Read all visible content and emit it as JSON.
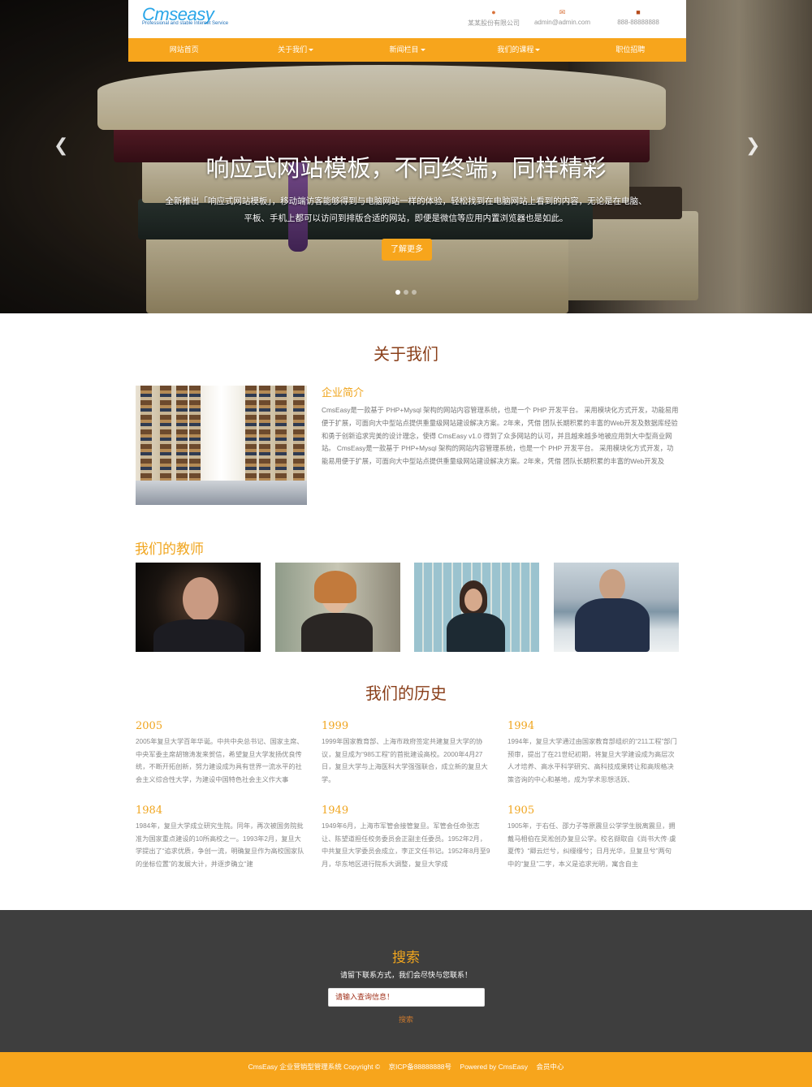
{
  "header": {
    "logo_text": "Cms",
    "logo_text2": "easy",
    "logo_tagline": "Professional and stable Internet Service",
    "contacts": [
      {
        "icon": "location-pin-icon",
        "text": "某某股份有限公司"
      },
      {
        "icon": "envelope-icon",
        "text": "admin@admin.com"
      },
      {
        "icon": "phone-icon",
        "text": "888-88888888"
      }
    ]
  },
  "nav": {
    "items": [
      {
        "label": "网站首页",
        "dropdown": false
      },
      {
        "label": "关于我们",
        "dropdown": true
      },
      {
        "label": "新闻栏目",
        "dropdown": true
      },
      {
        "label": "我们的课程",
        "dropdown": true
      },
      {
        "label": "职位招聘",
        "dropdown": false
      }
    ]
  },
  "slider": {
    "title": "响应式网站模板，不同终端，同样精彩",
    "description": "全新推出「响应式网站模板」，移动端访客能够得到与电脑网站一样的体验，轻松找到在电脑网站上看到的内容，无论是在电脑、平板、手机上都可以访问到排版合适的网站，即便是微信等应用内置浏览器也是如此。",
    "button": "了解更多",
    "prev_icon": "chevron-left-icon",
    "next_icon": "chevron-right-icon",
    "slide_count": 3,
    "active_slide": 1
  },
  "about": {
    "title": "关于我们",
    "subtitle": "企业简介",
    "text": "CmsEasy是一款基于 PHP+Mysql 架构的网站内容管理系统，也是一个 PHP 开发平台。 采用模块化方式开发，功能易用便于扩展，可面向大中型站点提供重量级网站建设解决方案。2年来，凭借 团队长期积累的丰富的Web开发及数据库经验和勇于创新追求完美的设计理念，使得 CmsEasy v1.0 得到了众多网站的认可，并且越来越多地被应用到大中型商业网站。 CmsEasy是一款基于 PHP+Mysql 架构的网站内容管理系统，也是一个 PHP 开发平台。 采用模块化方式开发，功能易用便于扩展，可面向大中型站点提供重量级网站建设解决方案。2年来，凭借 团队长期积累的丰富的Web开发及"
  },
  "teachers": {
    "title": "我们的教师"
  },
  "history": {
    "title": "我们的历史",
    "items": [
      {
        "year": "2005",
        "text": "2005年复旦大学百年华诞。中共中央总书记、国家主席、中央军委主席胡锦涛发来贺信，希望复旦大学发扬优良传统，不断开拓创新，努力建设成为具有世界一流水平的社会主义综合性大学，为建设中国特色社会主义作大事"
      },
      {
        "year": "1999",
        "text": "1999年国家教育部、上海市政府签定共建复旦大学的协议，复旦成为“985工程”的首批建设高校。2000年4月27日，复旦大学与上海医科大学强强联合，成立新的复旦大学。"
      },
      {
        "year": "1994",
        "text": "1994年，复旦大学通过由国家教育部组织的“211工程”部门预审，提出了在21世纪初期，将复旦大学建设成为高层次人才培养、高水平科学研究、高科技成果转让和高规格决策咨询的中心和基地，成为学术思想活跃、"
      },
      {
        "year": "1984",
        "text": "1984年，复旦大学成立研究生院。同年，再次被国务院批准为国家重点建设的10所高校之一。1993年2月，复旦大学提出了“追求优质，争创一流，明确复旦作为高校国家队的坐标位置”的发展大计，并逐步确立“建"
      },
      {
        "year": "1949",
        "text": "1949年6月，上海市军管会接管复旦。军管会任命张志让、陈望道担任校务委员会正副主任委员。1952年2月，中共复旦大学委员会成立，李正文任书记。1952年8月至9月，华东地区进行院系大调整，复旦大学成"
      },
      {
        "year": "1905",
        "text": "1905年，于右任、邵力子等原震旦公学学生脱离震旦，拥戴马相伯在吴淞创办复旦公学。校名撷取自《尚书大传·虞夏传》“卿云烂兮，纠缦缦兮；日月光华，旦复旦兮”两句中的“复旦”二字，本义是追求光明，寓含自主"
      }
    ]
  },
  "search": {
    "title": "搜索",
    "subtitle": "请留下联系方式，我们会尽快与您联系！",
    "placeholder": "请输入查询信息！",
    "button": "搜索"
  },
  "footer": {
    "company": "CmsEasy 企业营销型管理系统 Copyright ©",
    "icp": "京ICP备88888888号",
    "powered": "Powered by CmsEasy",
    "member": "会员中心"
  },
  "colors": {
    "accent": "#f7a51c",
    "title": "#8a3f1a",
    "dark_footer": "#3e3e3e"
  }
}
